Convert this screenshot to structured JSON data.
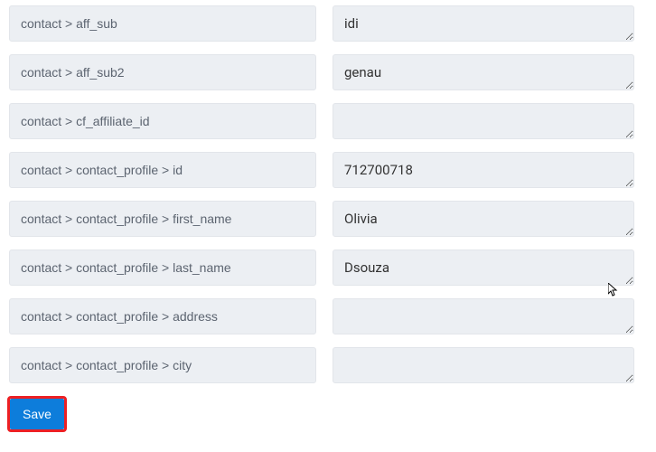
{
  "fields": [
    {
      "label": "contact > aff_sub",
      "value": "idi"
    },
    {
      "label": "contact > aff_sub2",
      "value": "genau"
    },
    {
      "label": "contact > cf_affiliate_id",
      "value": ""
    },
    {
      "label": "contact > contact_profile > id",
      "value": "712700718"
    },
    {
      "label": "contact > contact_profile > first_name",
      "value": "Olivia"
    },
    {
      "label": "contact > contact_profile > last_name",
      "value": "Dsouza"
    },
    {
      "label": "contact > contact_profile > address",
      "value": ""
    },
    {
      "label": "contact > contact_profile > city",
      "value": ""
    }
  ],
  "buttons": {
    "save_label": "Save"
  }
}
